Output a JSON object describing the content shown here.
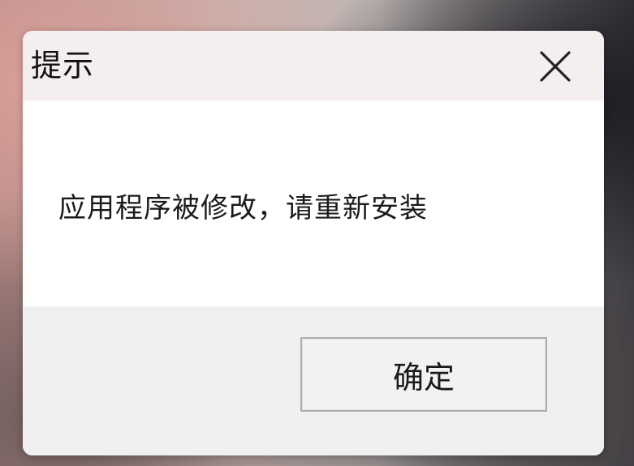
{
  "dialog": {
    "title": "提示",
    "close_icon": "close-icon",
    "message": "应用程序被修改，请重新安装",
    "ok_label": "确定"
  },
  "colors": {
    "title_bar": "#f4efee",
    "content_bg": "#ffffff",
    "footer_bg": "#f0f0f0",
    "button_border": "#adadad"
  }
}
